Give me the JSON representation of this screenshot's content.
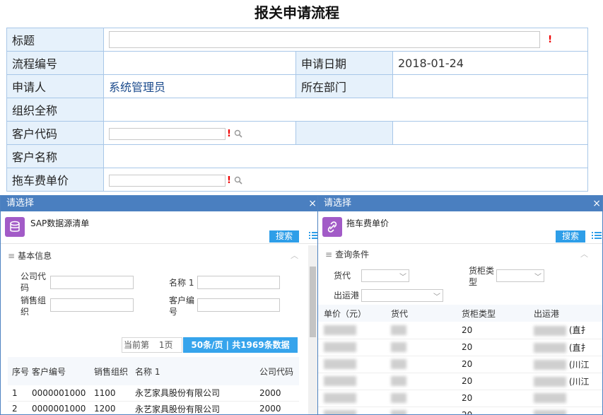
{
  "page": {
    "title": "报关申请流程"
  },
  "form": {
    "title_label": "标题",
    "process_no_label": "流程编号",
    "apply_date_label": "申请日期",
    "apply_date_value": "2018-01-24",
    "applicant_label": "申请人",
    "applicant_value": "系统管理员",
    "department_label": "所在部门",
    "org_fullname_label": "组织全称",
    "customer_code_label": "客户代码",
    "customer_name_label": "客户名称",
    "tow_price_label": "拖车费单价",
    "required_mark": "!"
  },
  "left_dialog": {
    "title": "请选择",
    "close": "×",
    "subtitle": "SAP数据源清单",
    "search_label": "搜索",
    "section_title": "基本信息",
    "fields": {
      "company_code": "公司代码",
      "name1": "名称 1",
      "sales_org": "销售组织",
      "customer_no": "客户编号"
    },
    "pager": {
      "current_prefix": "当前第",
      "current_page": "1页",
      "info": "50条/页 | 共1969条数据"
    },
    "columns": [
      "序号",
      "客户编号",
      "销售组织",
      "名称 1",
      "公司代码"
    ],
    "rows": [
      [
        "1",
        "0000001000",
        "1100",
        "永艺家具股份有限公司",
        "2000"
      ],
      [
        "2",
        "0000001000",
        "1200",
        "永艺家具股份有限公司",
        "2000"
      ]
    ]
  },
  "right_dialog": {
    "title": "请选择",
    "close": "×",
    "subtitle": "拖车费单价",
    "search_label": "搜索",
    "section_title": "查询条件",
    "fields": {
      "forwarder": "货代",
      "container_type": "货柜类型",
      "port": "出运港"
    },
    "columns": [
      "单价（元）",
      "货代",
      "货柜类型",
      "出运港"
    ],
    "rows": [
      {
        "container": "20",
        "port_suffix": "(直扌"
      },
      {
        "container": "20",
        "port_suffix": "(直扌"
      },
      {
        "container": "20",
        "port_suffix": "(川江"
      },
      {
        "container": "20",
        "port_suffix": "(川江"
      },
      {
        "container": "20",
        "port_suffix": ""
      },
      {
        "container": "20",
        "port_suffix": ""
      }
    ]
  },
  "colors": {
    "dialog_header": "#4a7fc0",
    "search_button": "#2e9ee8",
    "label_bg": "#e6f1fb",
    "border": "#a8c7e8",
    "required": "#ee0000"
  }
}
